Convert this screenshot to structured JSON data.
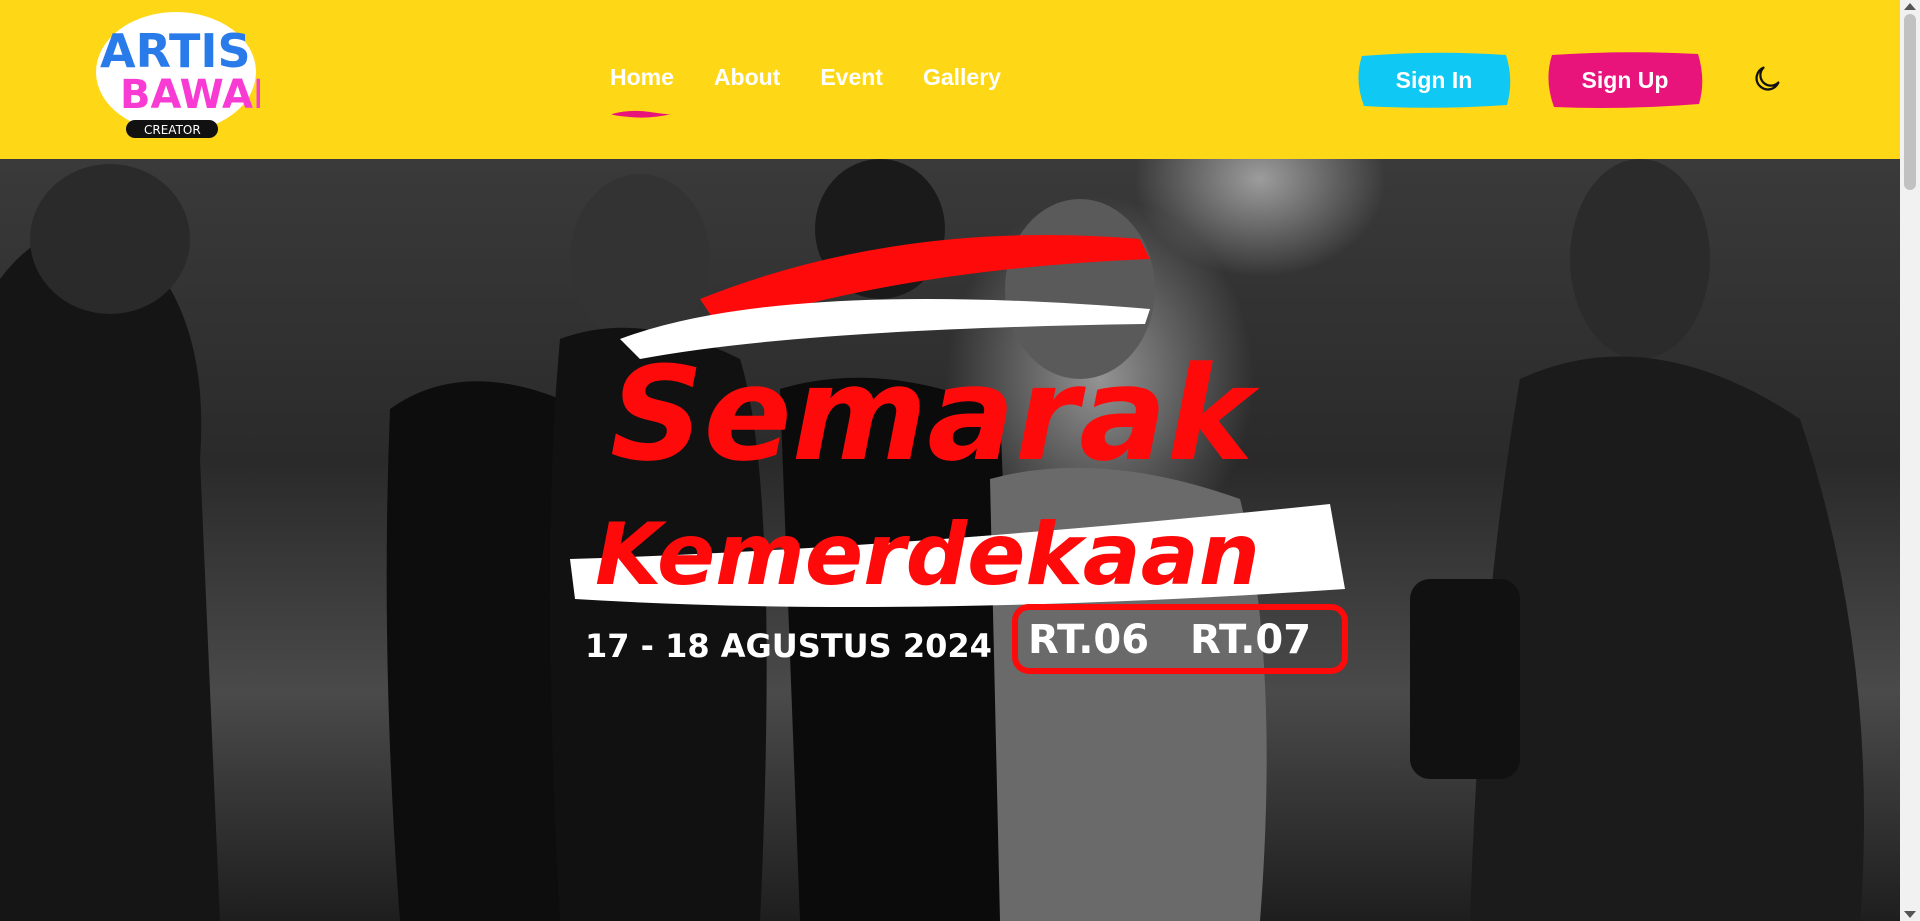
{
  "brand": {
    "logo_text": "ARTIS BAWAH",
    "logo_sub": "CREATOR"
  },
  "nav": {
    "items": [
      {
        "label": "Home"
      },
      {
        "label": "About"
      },
      {
        "label": "Event"
      },
      {
        "label": "Gallery"
      }
    ],
    "active": "Home"
  },
  "auth": {
    "signin_label": "Sign In",
    "signup_label": "Sign Up"
  },
  "hero": {
    "title_line1": "Semarak",
    "title_line2": "Kemerdekaan",
    "dates": "17 - 18 AGUSTUS 2024",
    "badge1": "RT.06",
    "badge2": "RT.07"
  },
  "colors": {
    "header_bg": "#FED716",
    "signin_bg": "#10C8F4",
    "signup_bg": "#E8137B",
    "accent_red": "#FF0A0A",
    "nav_underline": "#E8137B"
  },
  "icons": {
    "theme_toggle": "moon-icon"
  }
}
